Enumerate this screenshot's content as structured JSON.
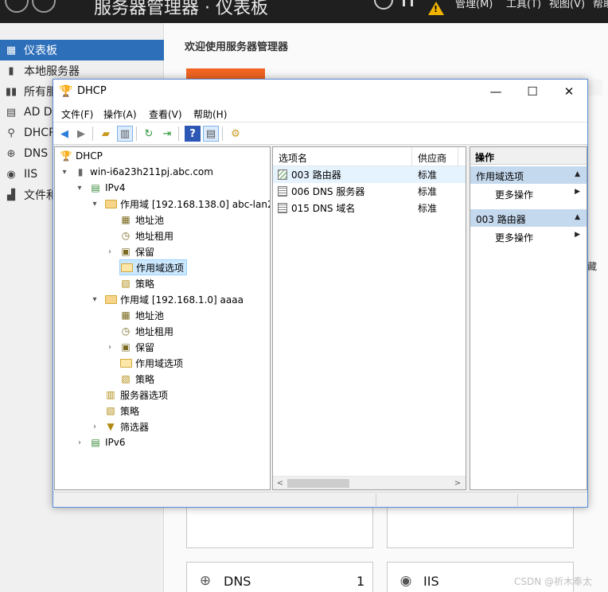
{
  "server_manager": {
    "title": "服务器管理器 · 仪表板",
    "menu": {
      "manage": "管理(M)",
      "tools": "工具(T)",
      "view": "视图(V)",
      "help": "帮助"
    },
    "sidebar": [
      {
        "label": "仪表板",
        "icon": "dashboard-icon",
        "active": true
      },
      {
        "label": "本地服务器",
        "icon": "server-icon",
        "active": false
      },
      {
        "label": "所有服务器",
        "icon": "servers-icon",
        "active": false
      },
      {
        "label": "AD DS",
        "icon": "ad-icon",
        "active": false
      },
      {
        "label": "DHCP",
        "icon": "dhcp-icon",
        "active": false
      },
      {
        "label": "DNS",
        "icon": "dns-icon",
        "active": false
      },
      {
        "label": "IIS",
        "icon": "iis-icon",
        "active": false
      },
      {
        "label": "文件和存储服务",
        "icon": "file-storage-icon",
        "active": false
      }
    ],
    "welcome": "欢迎使用服务器管理器",
    "partial_text": "藏",
    "tiles": [
      {
        "label": "DNS",
        "count": "1",
        "icon": "dns-icon"
      },
      {
        "label": "IIS",
        "count": "",
        "icon": "iis-icon"
      }
    ],
    "accent_color": "#f26522",
    "active_color": "#2d6fb9"
  },
  "dhcp_window": {
    "title": "DHCP",
    "controls": {
      "minimize": "—",
      "maximize": "☐",
      "close": "✕"
    },
    "menu": [
      "文件(F)",
      "操作(A)",
      "查看(V)",
      "帮助(H)"
    ],
    "tree": [
      {
        "label": "DHCP",
        "level": 0,
        "expander": "",
        "icon": "dhcp-icon"
      },
      {
        "label": "win-i6a23h211pj.abc.com",
        "level": 1,
        "expander": "▾",
        "icon": "server-icon"
      },
      {
        "label": "IPv4",
        "level": 2,
        "expander": "▾",
        "icon": "ipv4-icon"
      },
      {
        "label": "作用域 [192.168.138.0] abc-lan2",
        "level": 3,
        "expander": "▾",
        "icon": "folder-icon"
      },
      {
        "label": "地址池",
        "level": 4,
        "expander": "",
        "icon": "address-pool-icon"
      },
      {
        "label": "地址租用",
        "level": 4,
        "expander": "",
        "icon": "address-lease-icon"
      },
      {
        "label": "保留",
        "level": 4,
        "expander": "›",
        "icon": "reservation-icon"
      },
      {
        "label": "作用域选项",
        "level": 4,
        "expander": "",
        "icon": "scope-options-icon",
        "selected": true
      },
      {
        "label": "策略",
        "level": 4,
        "expander": "",
        "icon": "policy-icon"
      },
      {
        "label": "作用域 [192.168.1.0] aaaa",
        "level": 3,
        "expander": "▾",
        "icon": "folder-icon"
      },
      {
        "label": "地址池",
        "level": 4,
        "expander": "",
        "icon": "address-pool-icon"
      },
      {
        "label": "地址租用",
        "level": 4,
        "expander": "",
        "icon": "address-lease-icon"
      },
      {
        "label": "保留",
        "level": 4,
        "expander": "›",
        "icon": "reservation-icon"
      },
      {
        "label": "作用域选项",
        "level": 4,
        "expander": "",
        "icon": "scope-options-icon"
      },
      {
        "label": "策略",
        "level": 4,
        "expander": "",
        "icon": "policy-icon"
      },
      {
        "label": "服务器选项",
        "level": 3,
        "expander": "",
        "icon": "server-options-icon"
      },
      {
        "label": "策略",
        "level": 3,
        "expander": "",
        "icon": "policy-icon"
      },
      {
        "label": "筛选器",
        "level": 3,
        "expander": "›",
        "icon": "filter-icon"
      },
      {
        "label": "IPv6",
        "level": 2,
        "expander": "›",
        "icon": "ipv6-icon"
      }
    ],
    "list": {
      "columns": [
        "选项名",
        "供应商"
      ],
      "rows": [
        {
          "name": "003 路由器",
          "vendor": "标准",
          "selected": true
        },
        {
          "name": "006 DNS 服务器",
          "vendor": "标准",
          "selected": false
        },
        {
          "name": "015 DNS 域名",
          "vendor": "标准",
          "selected": false
        }
      ]
    },
    "actions": {
      "header": "操作",
      "sections": [
        {
          "title": "作用域选项",
          "item": "更多操作"
        },
        {
          "title": "003 路由器",
          "item": "更多操作"
        }
      ]
    }
  },
  "watermark": "CSDN @祈木奉太"
}
